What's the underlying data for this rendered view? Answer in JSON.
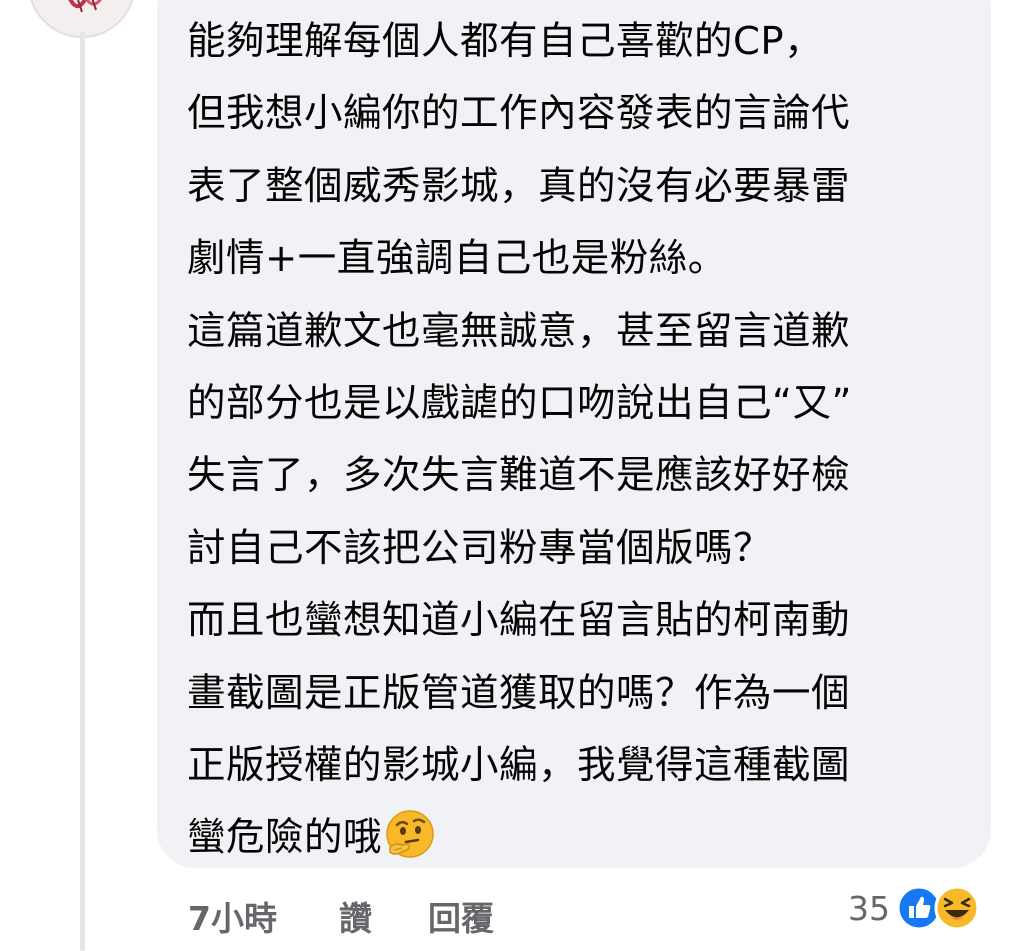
{
  "comment": {
    "lines": [
      "能夠理解每個人都有自己喜歡的CP，",
      "但我想小編你的工作內容發表的言論代",
      "表了整個威秀影城，真的沒有必要暴雷",
      "劇情+一直強調自己也是粉絲。",
      "這篇道歉文也毫無誠意，甚至留言道歉",
      "的部分也是以戲謔的口吻說出自己“又”",
      "失言了，多次失言難道不是應該好好檢",
      "討自己不該把公司粉專當個版嗎？",
      "而且也蠻想知道小編在留言貼的柯南動",
      "畫截圖是正版管道獲取的嗎？作為一個",
      "正版授權的影城小編，我覺得這種截圖",
      "蠻危險的哦"
    ],
    "trailing_emoji": "thinking-face-emoji"
  },
  "actions": {
    "time": "7小時",
    "like": "讚",
    "reply": "回覆"
  },
  "reactions": {
    "count": "35",
    "icons": [
      "like-reaction-icon",
      "haha-reaction-icon"
    ]
  },
  "colors": {
    "bubble": "#f0f2f5",
    "text": "#050505",
    "secondary": "#65676b",
    "like_blue": "#1877f2",
    "haha_yellow": "#f7b928"
  }
}
